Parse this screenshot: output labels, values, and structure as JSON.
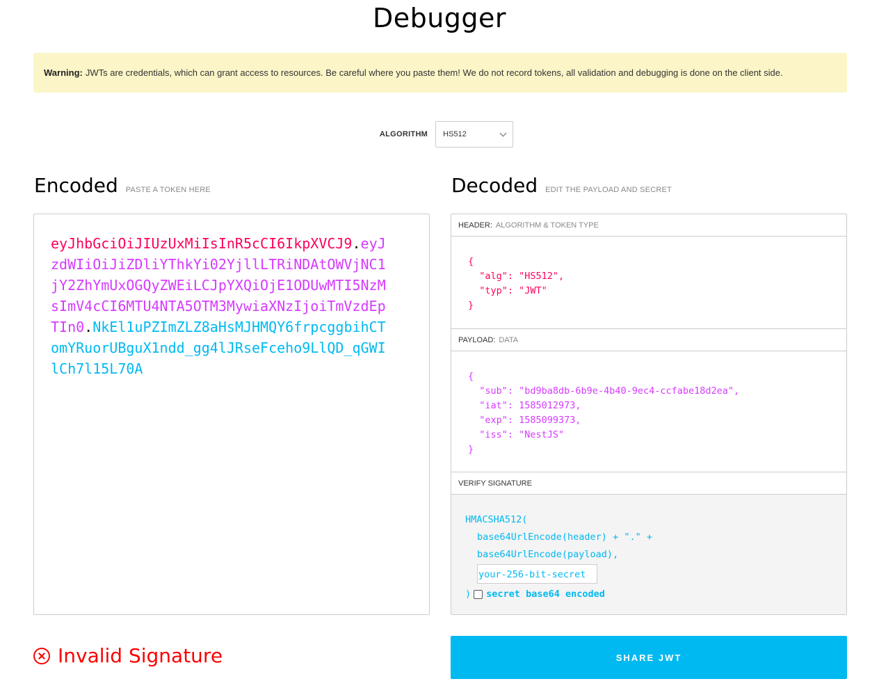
{
  "page": {
    "title": "Debugger"
  },
  "warning": {
    "label": "Warning:",
    "text": "JWTs are credentials, which can grant access to resources. Be careful where you paste them! We do not record tokens, all validation and debugging is done on the client side."
  },
  "algorithm": {
    "label": "ALGORITHM",
    "selected": "HS512"
  },
  "encoded": {
    "title": "Encoded",
    "hint": "PASTE A TOKEN HERE",
    "token_header": "eyJhbGciOiJIUzUxMiIsInR5cCI6IkpXVCJ9",
    "token_payload": "eyJzdWIiOiJiZDliYThkYi02YjllLTRiNDAtOWVjNC1jY2ZhYmUxOGQyZWEiLCJpYXQiOjE1ODUwMTI5NzMsImV4cCI6MTU4NTA5OTM3MywiaXNzIjoiTmVzdEpTIn0",
    "token_signature": "NkEl1uPZImZLZ8aHsMJHMQY6frpcggbihCTomYRuorUBguX1ndd_gg4lJRseFceho9LlQD_qGWIlCh7l15L70A",
    "dot": "."
  },
  "decoded": {
    "title": "Decoded",
    "hint": "EDIT THE PAYLOAD AND SECRET",
    "header": {
      "label": "HEADER:",
      "sub": "ALGORITHM & TOKEN TYPE",
      "lines": [
        "{",
        "  \"alg\": \"HS512\",",
        "  \"typ\": \"JWT\"",
        "}"
      ]
    },
    "payload": {
      "label": "PAYLOAD:",
      "sub": "DATA",
      "lines": [
        "{",
        "  \"sub\": \"bd9ba8db-6b9e-4b40-9ec4-ccfabe18d2ea\",",
        "  \"iat\": 1585012973,",
        "  \"exp\": 1585099373,",
        "  \"iss\": \"NestJS\"",
        "}"
      ]
    },
    "signature": {
      "label": "VERIFY SIGNATURE",
      "fn_open": "HMACSHA512(",
      "line1": "base64UrlEncode(header) + \".\" +",
      "line2": "base64UrlEncode(payload),",
      "secret_value": "your-256-bit-secret",
      "close_paren": ")",
      "checkbox_label_1": "secret",
      "checkbox_label_2": "base64",
      "checkbox_label_3": "encoded"
    }
  },
  "status": {
    "text": "Invalid Signature",
    "color": "#fb0000"
  },
  "share": {
    "label": "SHARE JWT"
  },
  "colors": {
    "header": "#fb015b",
    "payload": "#d63aff",
    "signature": "#00b9f1"
  }
}
